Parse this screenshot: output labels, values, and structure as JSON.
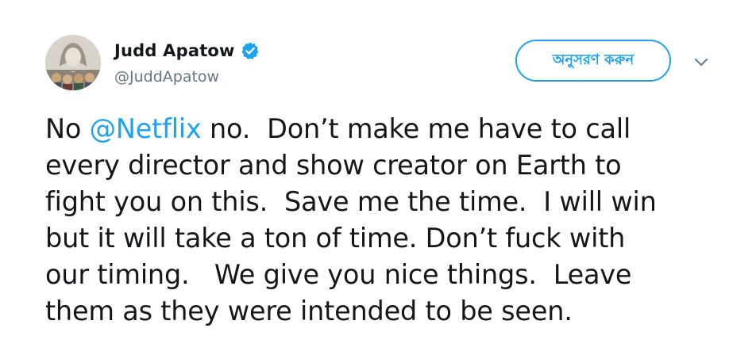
{
  "user": {
    "display_name": "Judd Apatow",
    "handle": "@JuddApatow",
    "verified": true,
    "avatar_icon": "avatar-photo"
  },
  "follow_button": {
    "label": "অনুসরণ করুন"
  },
  "menu": {
    "icon": "chevron-down-icon"
  },
  "tweet": {
    "lines": [
      {
        "before": "No ",
        "mention": "@Netflix",
        "after": " no.  Don’t make me have to call"
      },
      {
        "text": "every director and show creator on Earth to"
      },
      {
        "text": "fight you on this.  Save me the time.  I will win"
      },
      {
        "text": "but it will take a ton of time. Don’t fuck with"
      },
      {
        "text": "our timing.   We give you nice things.  Leave"
      },
      {
        "text": "them as they were intended to be seen."
      }
    ]
  },
  "colors": {
    "accent": "#1da1f2",
    "text": "#14171a",
    "secondary": "#657786"
  }
}
